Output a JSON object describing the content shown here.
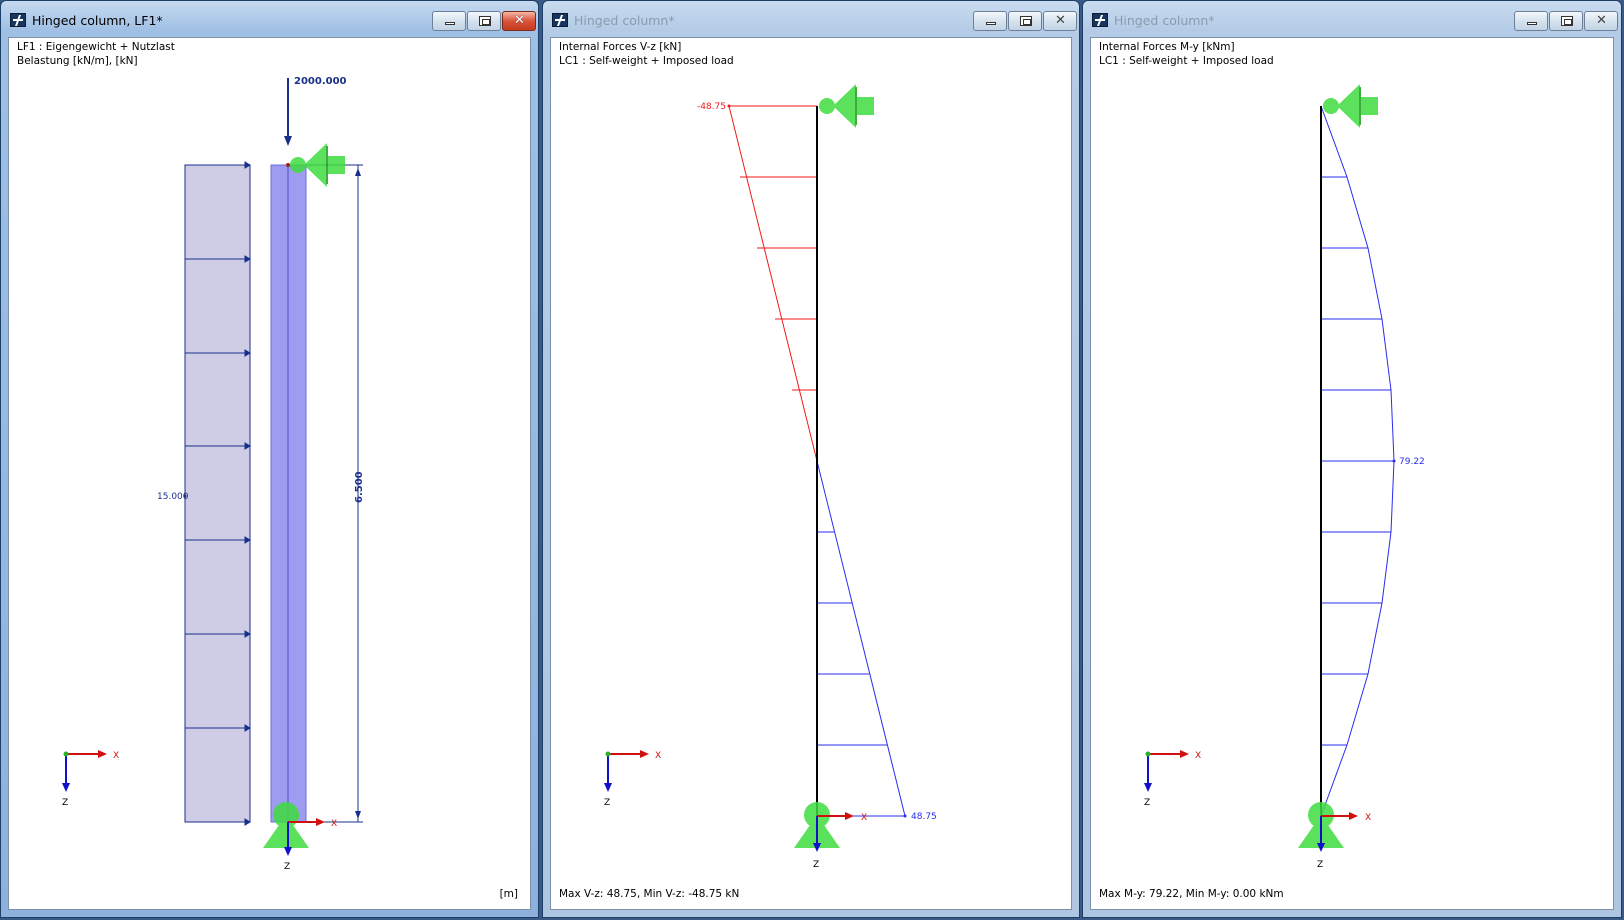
{
  "windows": [
    {
      "title": "Hinged column, LF1*",
      "header_line1": "LF1 : Eigengewicht + Nutzlast",
      "header_line2": "Belastung [kN/m], [kN]",
      "footer": "[m]",
      "point_load_label": "2000.000",
      "distributed_load_label": "15.000",
      "length_label": "6.500",
      "axis_x": "X",
      "axis_z": "Z",
      "member_axis_x": "X",
      "member_axis_z": "Z"
    },
    {
      "title": "Hinged column*",
      "header_line1": "Internal Forces V-z [kN]",
      "header_line2": "LC1 : Self-weight + Imposed load",
      "footer": "Max V-z: 48.75, Min V-z: -48.75 kN",
      "min_label": "-48.75",
      "max_label": "48.75",
      "axis_x": "X",
      "axis_z": "Z",
      "member_axis_x": "X",
      "member_axis_z": "Z"
    },
    {
      "title": "Hinged column*",
      "header_line1": "Internal Forces M-y [kNm]",
      "header_line2": "LC1 : Self-weight + Imposed load",
      "footer": "Max M-y: 79.22, Min M-y: 0.00 kNm",
      "max_label": "79.22",
      "axis_x": "X",
      "axis_z": "Z",
      "member_axis_x": "X",
      "member_axis_z": "Z"
    }
  ],
  "diagram_values": {
    "shear_top": -48.75,
    "shear_bottom": 48.75,
    "moment_max": 79.22,
    "stations": 9
  },
  "colors": {
    "load": "#1a2f8c",
    "load_fill": "#cfcde6",
    "member_fill": "#9d9cf0",
    "positive": "#2a2cf0",
    "negative": "#f01a1a",
    "support": "#3fdc3f",
    "axis_x": "#d01010",
    "axis_z": "#1010c8"
  }
}
